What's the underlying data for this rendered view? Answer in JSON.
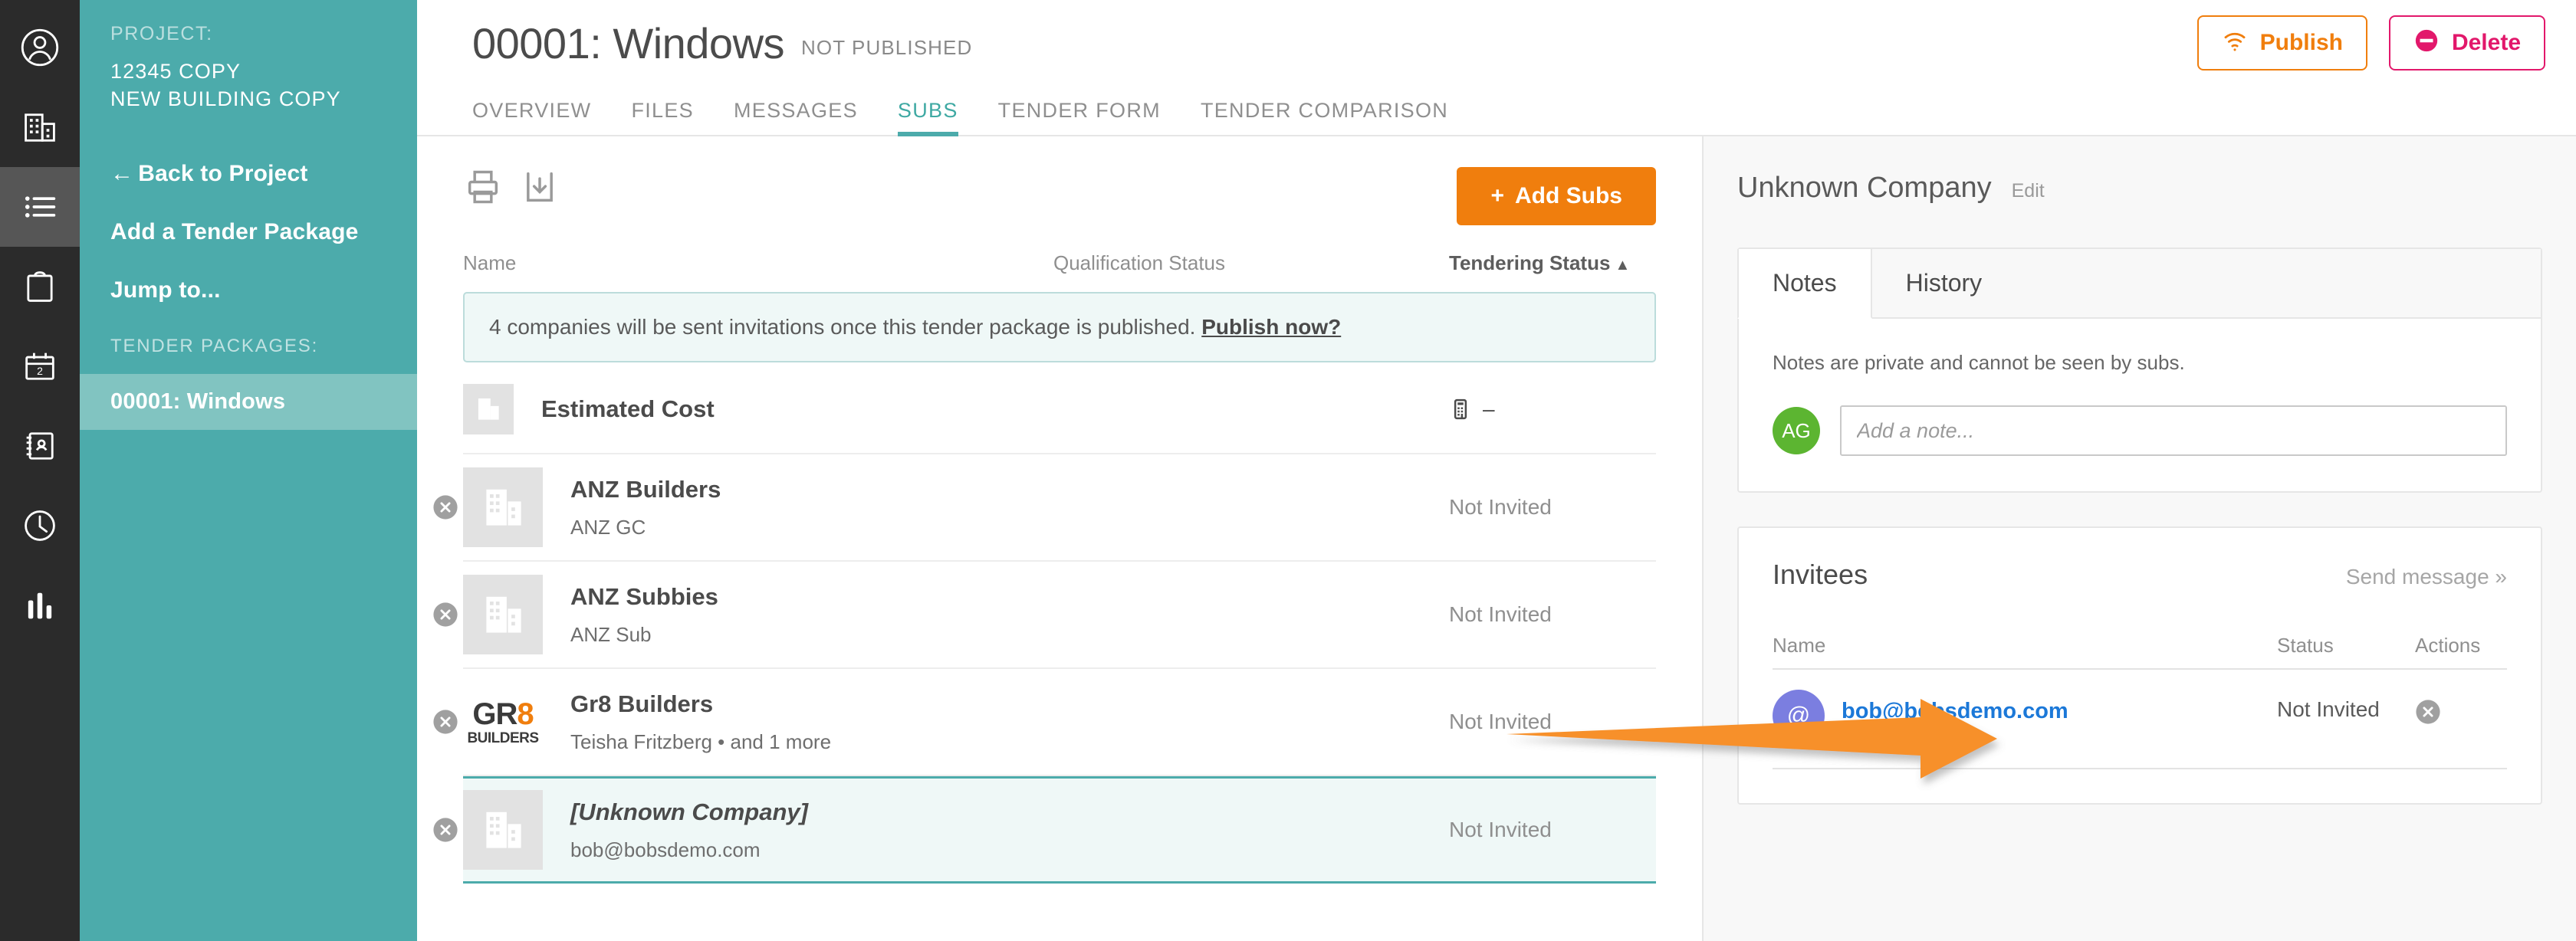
{
  "rail": {
    "items": [
      {
        "name": "profile-icon",
        "label": "Profile"
      },
      {
        "name": "company-icon",
        "label": "Companies"
      },
      {
        "name": "list-icon",
        "label": "Tender Packages"
      },
      {
        "name": "clipboard-icon",
        "label": "Tasks"
      },
      {
        "name": "calendar-icon",
        "label": "Calendar",
        "badge": "2"
      },
      {
        "name": "contacts-icon",
        "label": "Contacts"
      },
      {
        "name": "clock-icon",
        "label": "Timesheets"
      },
      {
        "name": "chart-icon",
        "label": "Reports"
      }
    ]
  },
  "sidebar": {
    "project_label": "PROJECT:",
    "project_number": "12345 COPY",
    "project_name": "NEW BUILDING COPY",
    "links": [
      {
        "arrow": "←",
        "label": "Back to Project"
      },
      {
        "arrow": "",
        "label": "Add a Tender Package"
      },
      {
        "arrow": "",
        "label": "Jump to..."
      }
    ],
    "packages_label": "TENDER PACKAGES:",
    "packages": [
      {
        "label": "00001: Windows",
        "active": true
      }
    ]
  },
  "header": {
    "title": "00001: Windows",
    "status": "NOT PUBLISHED",
    "publish_label": "Publish",
    "delete_label": "Delete",
    "publish_color": "#f07e0d",
    "delete_color": "#e2186b"
  },
  "tabs": [
    {
      "label": "OVERVIEW",
      "active": false
    },
    {
      "label": "FILES",
      "active": false
    },
    {
      "label": "MESSAGES",
      "active": false
    },
    {
      "label": "SUBS",
      "active": true
    },
    {
      "label": "TENDER FORM",
      "active": false
    },
    {
      "label": "TENDER COMPARISON",
      "active": false
    }
  ],
  "subs": {
    "toolbar": {
      "print_icon": "print-icon",
      "download_icon": "download-icon",
      "add_subs_label": "Add Subs",
      "add_subs_plus": "+"
    },
    "columns": {
      "name": "Name",
      "qualification": "Qualification Status",
      "tendering": "Tendering Status",
      "tendering_caret": "▲"
    },
    "notice": {
      "text": "4 companies will be sent invitations once this tender package is published.",
      "link": "Publish now?"
    },
    "estimated_cost": {
      "title": "Estimated Cost",
      "value": "–"
    },
    "rows": [
      {
        "title": "ANZ Builders",
        "subtitle": "ANZ GC",
        "tendering": "Not Invited",
        "logo": "building-placeholder",
        "selected": false
      },
      {
        "title": "ANZ Subbies",
        "subtitle": "ANZ Sub",
        "tendering": "Not Invited",
        "logo": "building-placeholder",
        "selected": false
      },
      {
        "title": "Gr8 Builders",
        "subtitle": "Teisha Fritzberg • and 1 more",
        "tendering": "Not Invited",
        "logo": "gr8-logo",
        "selected": false
      },
      {
        "title": "[Unknown Company]",
        "subtitle": "bob@bobsdemo.com",
        "tendering": "Not Invited",
        "logo": "building-placeholder",
        "selected": true
      }
    ]
  },
  "right_panel": {
    "company_name": "Unknown Company",
    "edit_label": "Edit",
    "tabs": [
      {
        "label": "Notes",
        "active": true
      },
      {
        "label": "History",
        "active": false
      }
    ],
    "notes": {
      "hint": "Notes are private and cannot be seen by subs.",
      "avatar_initials": "AG",
      "placeholder": "Add a note..."
    },
    "invitees": {
      "title": "Invitees",
      "send_message": "Send message »",
      "columns": {
        "name": "Name",
        "status": "Status",
        "actions": "Actions"
      },
      "rows": [
        {
          "avatar": "@",
          "email": "bob@bobsdemo.com",
          "status": "Not Invited"
        }
      ]
    }
  },
  "annotation": {
    "arrow_color": "#f79029",
    "description": "orange-arrow pointing to invitee avatar"
  }
}
